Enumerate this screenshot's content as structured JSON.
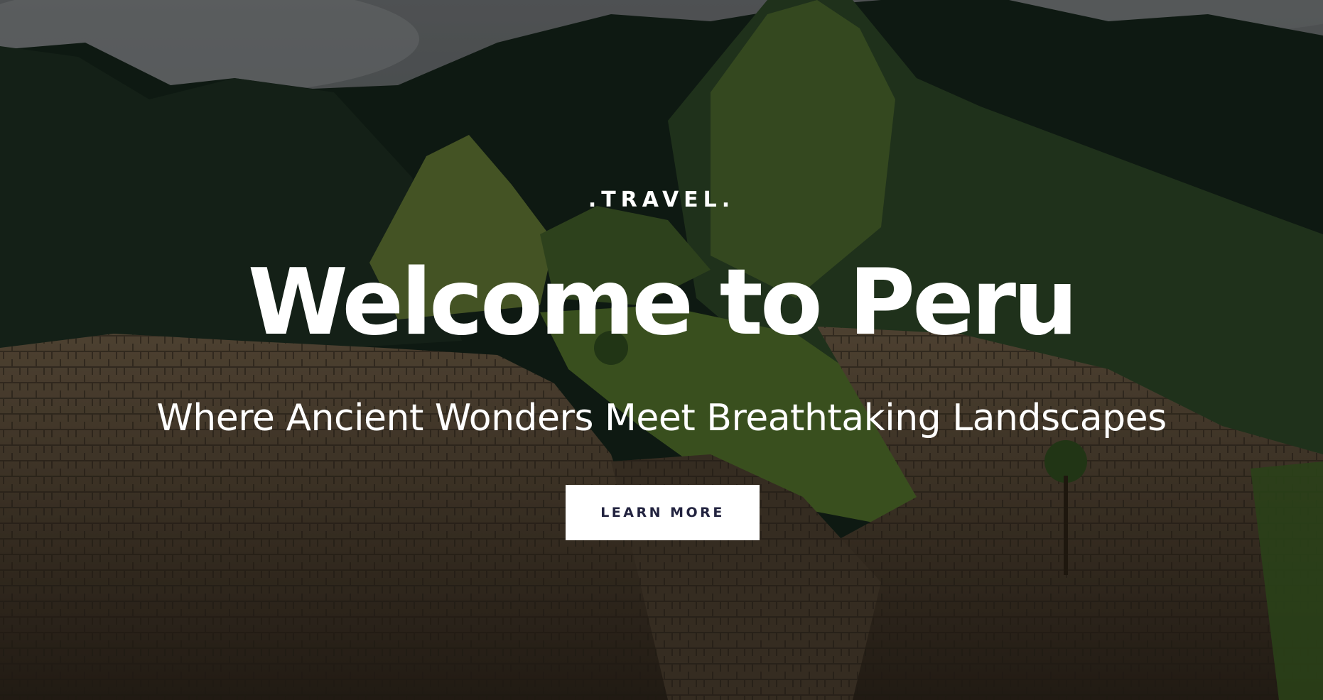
{
  "hero": {
    "eyebrow": ".TRAVEL.",
    "title": "Welcome to Peru",
    "subtitle": "Where Ancient Wonders Meet Breathtaking Landscapes",
    "cta_label": "LEARN MORE"
  },
  "colors": {
    "text": "#ffffff",
    "button_bg": "#ffffff",
    "button_text": "#22233f"
  }
}
